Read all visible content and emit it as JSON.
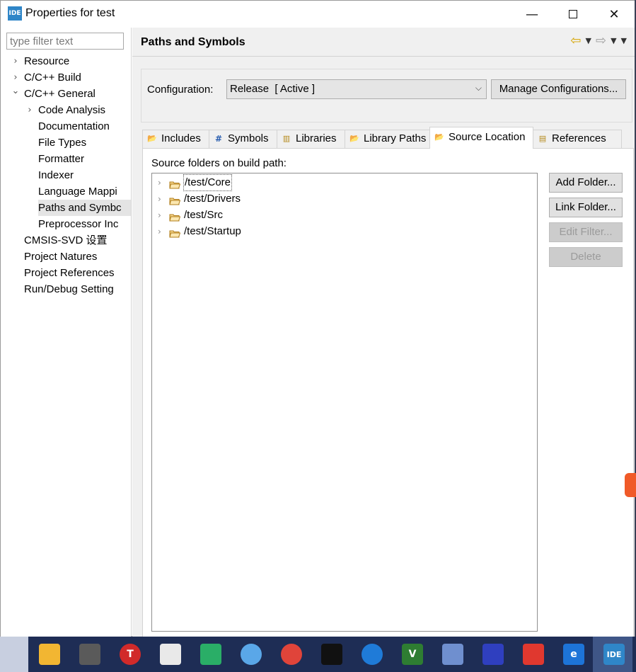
{
  "window": {
    "icon_text": "IDE",
    "title": "Properties for test",
    "minimize_glyph": "—",
    "close_glyph": "✕"
  },
  "left_nav": {
    "filter_placeholder": "type filter text",
    "items": [
      {
        "label": "Resource",
        "level": 0,
        "twisty": ">"
      },
      {
        "label": "C/C++ Build",
        "level": 0,
        "twisty": ">"
      },
      {
        "label": "C/C++ General",
        "level": 0,
        "twisty": "v"
      },
      {
        "label": "Code Analysis",
        "level": 1,
        "twisty": ">"
      },
      {
        "label": "Documentation",
        "level": 1,
        "twisty": ""
      },
      {
        "label": "File Types",
        "level": 1,
        "twisty": ""
      },
      {
        "label": "Formatter",
        "level": 1,
        "twisty": ""
      },
      {
        "label": "Indexer",
        "level": 1,
        "twisty": ""
      },
      {
        "label": "Language Mappi",
        "level": 1,
        "twisty": ""
      },
      {
        "label": "Paths and Symbc",
        "level": 1,
        "twisty": "",
        "selected": true
      },
      {
        "label": "Preprocessor Inc",
        "level": 1,
        "twisty": ""
      },
      {
        "label": "CMSIS-SVD 设置",
        "level": 0,
        "twisty": ""
      },
      {
        "label": "Project Natures",
        "level": 0,
        "twisty": ""
      },
      {
        "label": "Project References",
        "level": 0,
        "twisty": ""
      },
      {
        "label": "Run/Debug Setting",
        "level": 0,
        "twisty": ""
      }
    ]
  },
  "page": {
    "title": "Paths and Symbols",
    "config_label": "Configuration:",
    "config_value": "Release  [ Active ]",
    "manage_button": "Manage Configurations...",
    "tabs": [
      {
        "label": "Includes",
        "icon": "includes-icon",
        "active": false
      },
      {
        "label": "Symbols",
        "icon": "symbols-icon",
        "active": false
      },
      {
        "label": "Libraries",
        "icon": "libraries-icon",
        "active": false
      },
      {
        "label": "Library Paths",
        "icon": "library-paths-icon",
        "active": false
      },
      {
        "label": "Source Location",
        "icon": "source-location-icon",
        "active": true
      },
      {
        "label": "References",
        "icon": "references-icon",
        "active": false
      }
    ],
    "source_label": "Source folders on build path:",
    "source_folders": [
      "/test/Core",
      "/test/Drivers",
      "/test/Src",
      "/test/Startup"
    ],
    "buttons": {
      "add_folder": "Add Folder...",
      "link_folder": "Link Folder...",
      "edit_filter": "Edit Filter...",
      "delete": "Delete"
    }
  },
  "taskbar": {
    "apps": [
      {
        "name": "file-explorer-icon",
        "color": "#f2b632"
      },
      {
        "name": "calculator-icon",
        "color": "#5a5a5a"
      },
      {
        "name": "stop-t-icon",
        "color": "#d12a2a",
        "text": "T"
      },
      {
        "name": "graph-app-icon",
        "color": "#e9e9e9"
      },
      {
        "name": "wechat-icon",
        "color": "#2aae67"
      },
      {
        "name": "cloud-icon",
        "color": "#5aa7e8"
      },
      {
        "name": "chrome-icon",
        "color": "#e0443a"
      },
      {
        "name": "star-app-icon",
        "color": "#111111"
      },
      {
        "name": "spiral-app-icon",
        "color": "#1f7bd8"
      },
      {
        "name": "vs-app-icon",
        "color": "#2e7d32",
        "text": "V"
      },
      {
        "name": "building-app-icon",
        "color": "#6f8fcf"
      },
      {
        "name": "city-app-icon",
        "color": "#2f3fbf"
      },
      {
        "name": "bear-app-icon",
        "color": "#e0382f"
      },
      {
        "name": "edge-icon",
        "color": "#1d74d8",
        "text": "e"
      },
      {
        "name": "ide-taskbar-icon",
        "color": "#2f86c8",
        "text": "IDE"
      }
    ]
  }
}
